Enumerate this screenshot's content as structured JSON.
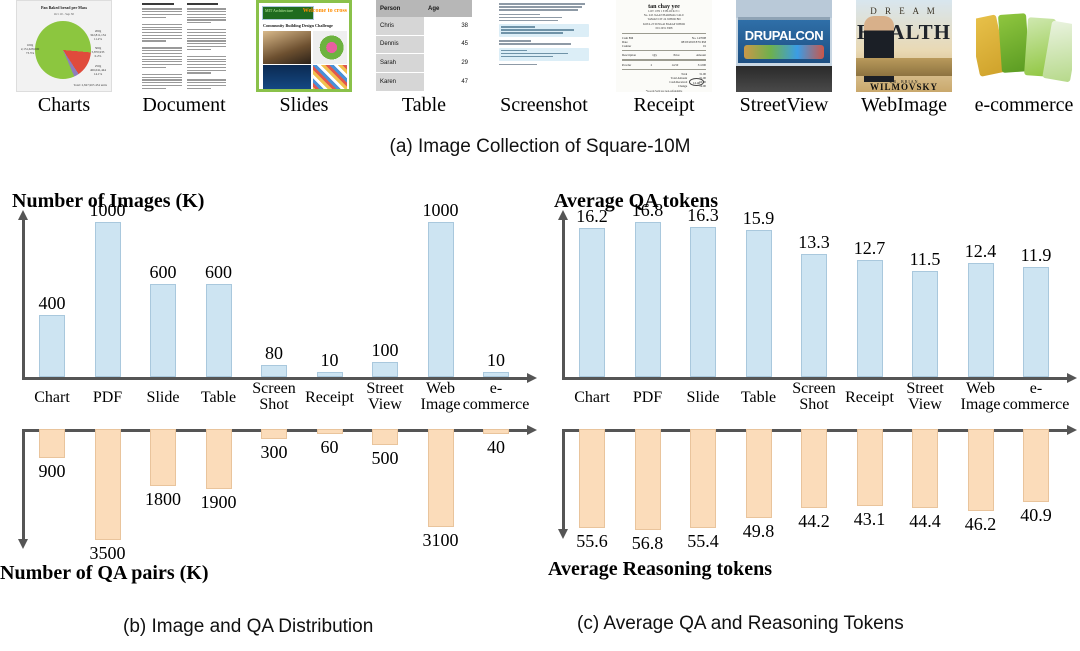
{
  "figure": {
    "caption_a": "(a) Image Collection of Square-10M",
    "caption_b": "(b) Image and QA Distribution",
    "caption_c": "(c) Average QA and Reasoning Tokens"
  },
  "thumbnails": [
    {
      "label": "Charts",
      "kind": "pie-chart-thumbnail"
    },
    {
      "label": "Document",
      "kind": "document-page-thumbnail"
    },
    {
      "label": "Slides",
      "kind": "presentation-slide-thumbnail"
    },
    {
      "label": "Table",
      "kind": "data-table-thumbnail"
    },
    {
      "label": "Screenshot",
      "kind": "chat-screenshot-thumbnail"
    },
    {
      "label": "Receipt",
      "kind": "receipt-thumbnail"
    },
    {
      "label": "StreetView",
      "kind": "streetview-photo-thumbnail"
    },
    {
      "label": "WebImage",
      "kind": "book-cover-thumbnail"
    },
    {
      "label": "e-commerce",
      "kind": "product-packets-thumbnail"
    }
  ],
  "thumbnail_content": {
    "charts": {
      "title": "Pan Baked bread per Mass",
      "subtitle": "Oct 10 - Sep 30",
      "footer": "Total: 2,847,965 454 units",
      "slices": [
        {
          "label": "100g\n2,151,628,000\n73.3%"
        },
        {
          "label": "200g\n322,811,154\n11.2%"
        },
        {
          "label": "500g\n5,870,933\n0.2%"
        },
        {
          "label": "250g\n406,041,444\n14.1%"
        }
      ]
    },
    "slides": {
      "org": "MIT Architecture",
      "welcome": "Welcome to cross",
      "subtitle": "Community Building Design Challenge"
    },
    "table": {
      "columns": [
        "Person",
        "Age"
      ],
      "rows": [
        {
          "person": "Chris",
          "age": "38"
        },
        {
          "person": "Dennis",
          "age": "45"
        },
        {
          "person": "Sarah",
          "age": "29"
        },
        {
          "person": "Karen",
          "age": "47"
        }
      ]
    },
    "receipt": {
      "merchant": "tan chay yee",
      "total_circle": "12.40"
    },
    "streetview": {
      "sign_text": "DRUPALCON"
    },
    "webimage": {
      "line1": "D R E A M",
      "line2": "HEALTH",
      "author_prefix": "DR. BRIAN",
      "author_name": "WILMOVSKY"
    }
  },
  "chart_data": [
    {
      "id": "b",
      "type": "bar",
      "title": "(b) Image and QA Distribution",
      "orientation": "dual-vertical-diverging",
      "categories": [
        "Chart",
        "PDF",
        "Slide",
        "Table",
        "Screen\nShot",
        "Receipt",
        "Street\nView",
        "Web\nImage",
        "e-\ncommerce"
      ],
      "category_lines": [
        [
          "Chart"
        ],
        [
          "PDF"
        ],
        [
          "Slide"
        ],
        [
          "Table"
        ],
        [
          "Screen",
          "Shot"
        ],
        [
          "Receipt"
        ],
        [
          "Street",
          "View"
        ],
        [
          "Web",
          "Image"
        ],
        [
          "e-",
          "commerce"
        ]
      ],
      "series": [
        {
          "name": "Number of Images (K)",
          "direction": "up",
          "ylabel": "Number of Images (K)",
          "color": "#cde4f2",
          "values": [
            400,
            1000,
            600,
            600,
            80,
            10,
            100,
            1000,
            10
          ],
          "ymax": 1000
        },
        {
          "name": "Number of QA pairs (K)",
          "direction": "down",
          "ylabel": "Number of QA pairs (K)",
          "color": "#fbdcba",
          "values": [
            900,
            3500,
            1800,
            1900,
            300,
            60,
            500,
            3100,
            40
          ],
          "ymax": 3500
        }
      ],
      "grid": false,
      "legend": "none"
    },
    {
      "id": "c",
      "type": "bar",
      "title": "(c) Average QA and Reasoning Tokens",
      "orientation": "dual-vertical-diverging",
      "categories": [
        "Chart",
        "PDF",
        "Slide",
        "Table",
        "Screen\nShot",
        "Receipt",
        "Street\nView",
        "Web\nImage",
        "e-\ncommerce"
      ],
      "category_lines": [
        [
          "Chart"
        ],
        [
          "PDF"
        ],
        [
          "Slide"
        ],
        [
          "Table"
        ],
        [
          "Screen",
          "Shot"
        ],
        [
          "Receipt"
        ],
        [
          "Street",
          "View"
        ],
        [
          "Web",
          "Image"
        ],
        [
          "e-",
          "commerce"
        ]
      ],
      "series": [
        {
          "name": "Average QA tokens",
          "direction": "up",
          "ylabel": "Average QA tokens",
          "color": "#cde4f2",
          "values": [
            16.2,
            16.8,
            16.3,
            15.9,
            13.3,
            12.7,
            11.5,
            12.4,
            11.9
          ],
          "ymax": 16.8
        },
        {
          "name": "Average Reasoning tokens",
          "direction": "down",
          "ylabel": "Average Reasoning tokens",
          "color": "#fbdcba",
          "values": [
            55.6,
            56.8,
            55.4,
            49.8,
            44.2,
            43.1,
            44.4,
            46.2,
            40.9
          ],
          "ymax": 56.8
        }
      ],
      "grid": false,
      "legend": "none"
    }
  ],
  "colors": {
    "bar_blue": "#cde4f2",
    "bar_blue_border": "#a9c8dd",
    "bar_orange": "#fbdcba",
    "bar_orange_border": "#e9c49c",
    "axis": "#555555",
    "text": "#000000"
  }
}
